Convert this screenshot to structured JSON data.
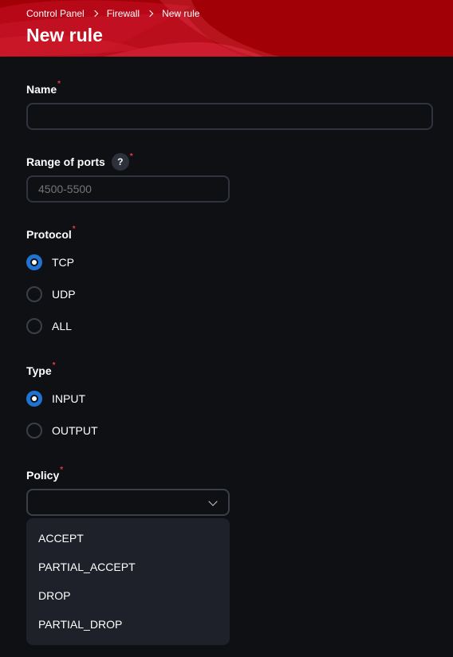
{
  "header": {
    "breadcrumb": [
      "Control Panel",
      "Firewall",
      "New rule"
    ],
    "title": "New rule",
    "accent_color": "#a00006"
  },
  "form": {
    "name": {
      "label": "Name",
      "required_mark": "*",
      "value": ""
    },
    "ports": {
      "label": "Range of ports",
      "help_glyph": "?",
      "required_mark": "*",
      "placeholder": "4500-5500",
      "value": ""
    },
    "protocol": {
      "label": "Protocol",
      "required_mark": "*",
      "options": [
        "TCP",
        "UDP",
        "ALL"
      ],
      "selected": "TCP"
    },
    "type": {
      "label": "Type",
      "required_mark": "*",
      "options": [
        "INPUT",
        "OUTPUT"
      ],
      "selected": "INPUT"
    },
    "policy": {
      "label": "Policy",
      "required_mark": "*",
      "value": "",
      "options": [
        "ACCEPT",
        "PARTIAL_ACCEPT",
        "DROP",
        "PARTIAL_DROP"
      ],
      "dropdown_open": true
    }
  },
  "colors": {
    "background": "#0f1014",
    "radio_selected": "#1f73d2",
    "required": "#e8364a",
    "dropdown_bg": "#1e2129"
  }
}
